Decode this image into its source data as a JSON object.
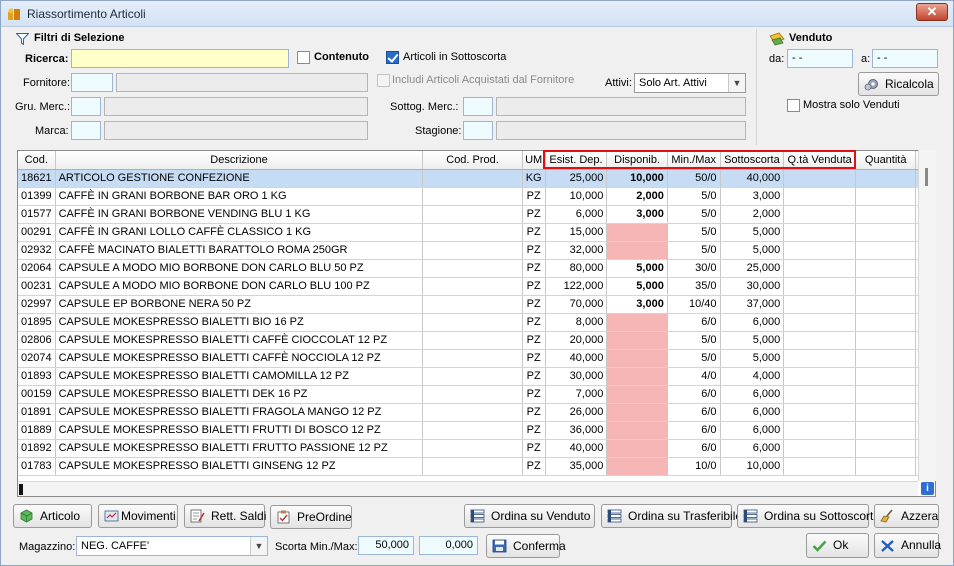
{
  "window": {
    "title": "Riassortimento Articoli",
    "close_label": "✕"
  },
  "filters": {
    "title": "Filtri di Selezione",
    "ricerca_label": "Ricerca:",
    "ricerca_value": "",
    "contenuto_label": "Contenuto",
    "sottoscorta_label": "Articoli in Sottoscorta",
    "fornitore_label": "Fornitore:",
    "includi_label": "Includi Articoli Acquistati dal Fornitore",
    "attivi_label": "Attivi:",
    "attivi_value": "Solo Art. Attivi",
    "gru_merc_label": "Gru. Merc.:",
    "sottog_merc_label": "Sottog. Merc.:",
    "marca_label": "Marca:",
    "stagione_label": "Stagione:"
  },
  "venduto": {
    "title": "Venduto",
    "da_label": "da:",
    "da_value": "-  -",
    "a_label": "a:",
    "a_value": "-  -",
    "ricalcola_label": "Ricalcola",
    "mostra_label": "Mostra solo Venduti"
  },
  "table": {
    "columns": [
      "Cod.",
      "Descrizione",
      "Cod. Prod.",
      "UM",
      "Esist. Dep.",
      "Disponib.",
      "Min./Max",
      "Sottoscorta",
      "Q.tà Venduta",
      "Quantità"
    ],
    "rows": [
      [
        "18621",
        "ARTICOLO GESTIONE CONFEZIONE",
        "",
        "KG",
        "25,000",
        "10,000",
        "50/0",
        "40,000",
        "",
        ""
      ],
      [
        "01399",
        "CAFFÈ IN GRANI BORBONE BAR ORO 1 KG",
        "",
        "PZ",
        "10,000",
        "2,000",
        "5/0",
        "3,000",
        "",
        ""
      ],
      [
        "01577",
        "CAFFÈ IN GRANI BORBONE VENDING BLU 1 KG",
        "",
        "PZ",
        "6,000",
        "3,000",
        "5/0",
        "2,000",
        "",
        ""
      ],
      [
        "00291",
        "CAFFÈ IN GRANI LOLLO CAFFÈ CLASSICO 1 KG",
        "",
        "PZ",
        "15,000",
        "",
        "5/0",
        "5,000",
        "",
        ""
      ],
      [
        "02932",
        "CAFFÈ MACINATO BIALETTI BARATTOLO ROMA 250GR",
        "",
        "PZ",
        "32,000",
        "",
        "5/0",
        "5,000",
        "",
        ""
      ],
      [
        "02064",
        "CAPSULE A MODO MIO BORBONE DON CARLO  BLU  50 PZ",
        "",
        "PZ",
        "80,000",
        "5,000",
        "30/0",
        "25,000",
        "",
        ""
      ],
      [
        "00231",
        "CAPSULE A MODO MIO BORBONE DON CARLO  BLU 100 PZ",
        "",
        "PZ",
        "122,000",
        "5,000",
        "35/0",
        "30,000",
        "",
        ""
      ],
      [
        "02997",
        "CAPSULE EP BORBONE  NERA  50 PZ",
        "",
        "PZ",
        "70,000",
        "3,000",
        "10/40",
        "37,000",
        "",
        ""
      ],
      [
        "01895",
        "CAPSULE MOKESPRESSO BIALETTI BIO 16 PZ",
        "",
        "PZ",
        "8,000",
        "",
        "6/0",
        "6,000",
        "",
        ""
      ],
      [
        "02806",
        "CAPSULE MOKESPRESSO BIALETTI CAFFÈ CIOCCOLAT 12 PZ",
        "",
        "PZ",
        "20,000",
        "",
        "5/0",
        "5,000",
        "",
        ""
      ],
      [
        "02074",
        "CAPSULE MOKESPRESSO BIALETTI CAFFÈ NOCCIOLA 12 PZ",
        "",
        "PZ",
        "40,000",
        "",
        "5/0",
        "5,000",
        "",
        ""
      ],
      [
        "01893",
        "CAPSULE MOKESPRESSO BIALETTI CAMOMILLA 12 PZ",
        "",
        "PZ",
        "30,000",
        "",
        "4/0",
        "4,000",
        "",
        ""
      ],
      [
        "00159",
        "CAPSULE MOKESPRESSO BIALETTI DEK 16 PZ",
        "",
        "PZ",
        "7,000",
        "",
        "6/0",
        "6,000",
        "",
        ""
      ],
      [
        "01891",
        "CAPSULE MOKESPRESSO BIALETTI FRAGOLA MANGO 12 PZ",
        "",
        "PZ",
        "26,000",
        "",
        "6/0",
        "6,000",
        "",
        ""
      ],
      [
        "01889",
        "CAPSULE MOKESPRESSO BIALETTI FRUTTI DI BOSCO 12 PZ",
        "",
        "PZ",
        "36,000",
        "",
        "6/0",
        "6,000",
        "",
        ""
      ],
      [
        "01892",
        "CAPSULE MOKESPRESSO BIALETTI FRUTTO PASSIONE 12 PZ",
        "",
        "PZ",
        "40,000",
        "",
        "6/0",
        "6,000",
        "",
        ""
      ],
      [
        "01783",
        "CAPSULE MOKESPRESSO BIALETTI GINSENG 12 PZ",
        "",
        "PZ",
        "35,000",
        "",
        "10/0",
        "10,000",
        "",
        ""
      ]
    ],
    "info_label": "i"
  },
  "buttons": {
    "articolo": "Articolo",
    "movimenti": "Movimenti",
    "rett_saldi": "Rett. Saldi",
    "preordine": "PreOrdine",
    "ordina_venduto": "Ordina su Venduto",
    "ordina_trasferibile": "Ordina su Trasferibile",
    "ordina_sottoscorta": "Ordina su Sottoscorta",
    "azzera": "Azzera",
    "conferma": "Conferma",
    "ok": "Ok",
    "annulla": "Annulla"
  },
  "footer": {
    "magazzino_label": "Magazzino:",
    "magazzino_value": "NEG. CAFFE'",
    "scorta_label": "Scorta Min./Max:",
    "scorta_min": "50,000",
    "scorta_max": "0,000"
  },
  "colors": {
    "pink": "#f7b6b6",
    "selected_row": "#c5dcf4",
    "highlight_border": "#e01010"
  }
}
